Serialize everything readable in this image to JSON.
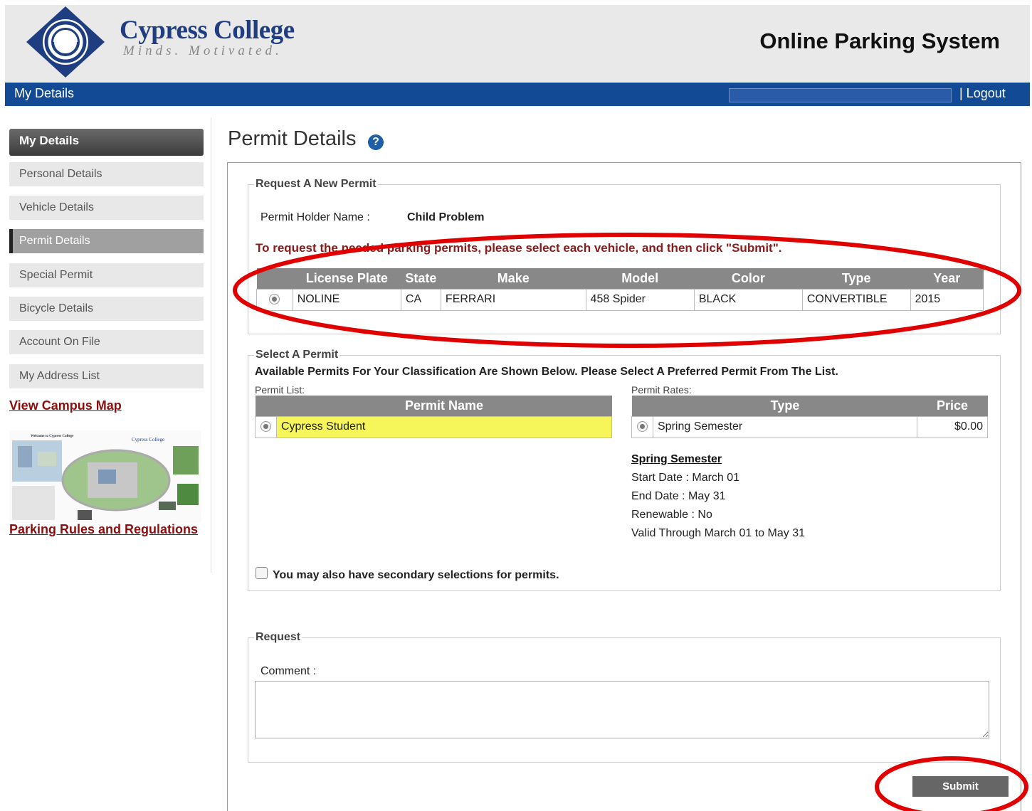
{
  "header": {
    "logo_name": "Cypress College",
    "logo_tagline": "Minds. Motivated.",
    "system_title": "Online Parking System"
  },
  "navbar": {
    "my_details": "My Details",
    "logout": "| Logout"
  },
  "sidebar": {
    "heading": "My Details",
    "items": [
      {
        "label": "Personal Details"
      },
      {
        "label": "Vehicle Details"
      },
      {
        "label": "Permit Details"
      },
      {
        "label": "Special Permit"
      },
      {
        "label": "Bicycle Details"
      },
      {
        "label": "Account On File"
      },
      {
        "label": "My Address List"
      }
    ],
    "campus_map_link": "View Campus Map",
    "rules_link": "Parking Rules and Regulations",
    "map_title": "Welcome to Cypress College",
    "map_logo": "Cypress College"
  },
  "page": {
    "title": "Permit Details",
    "help_icon": "?"
  },
  "request_new": {
    "legend": "Request A New Permit",
    "holder_label": "Permit Holder Name :",
    "holder_value": "Child Problem",
    "instruction": "To request the needed parking permits, please select each vehicle, and then click \"Submit\".",
    "columns": [
      "License Plate",
      "State",
      "Make",
      "Model",
      "Color",
      "Type",
      "Year"
    ],
    "vehicle": {
      "plate": "NOLINE",
      "state": "CA",
      "make": "FERRARI",
      "model": "458 Spider",
      "color": "BLACK",
      "type": "CONVERTIBLE",
      "year": "2015"
    }
  },
  "select_permit": {
    "legend": "Select A Permit",
    "heading": "Available Permits For Your Classification Are Shown Below. Please Select A Preferred Permit From The List.",
    "list_label": "Permit List:",
    "rates_label": "Permit Rates:",
    "list_header": "Permit Name",
    "permit_name": "Cypress Student",
    "rates_headers": [
      "Type",
      "Price"
    ],
    "rate_type": "Spring Semester",
    "rate_price": "$0.00",
    "semester_title": "Spring Semester",
    "start_date": "Start Date : March 01",
    "end_date": "End Date : May 31",
    "renewable": "Renewable : No",
    "valid_through": "Valid Through March 01 to May 31",
    "secondary_label": "You may also have secondary selections for permits."
  },
  "request": {
    "legend": "Request",
    "comment_label": "Comment :",
    "comment_value": "",
    "submit_label": "Submit"
  },
  "colors": {
    "navbar": "#134a95",
    "header_bg": "#e9e9e9",
    "highlight": "#f6f65a",
    "annotation": "#e00000"
  }
}
